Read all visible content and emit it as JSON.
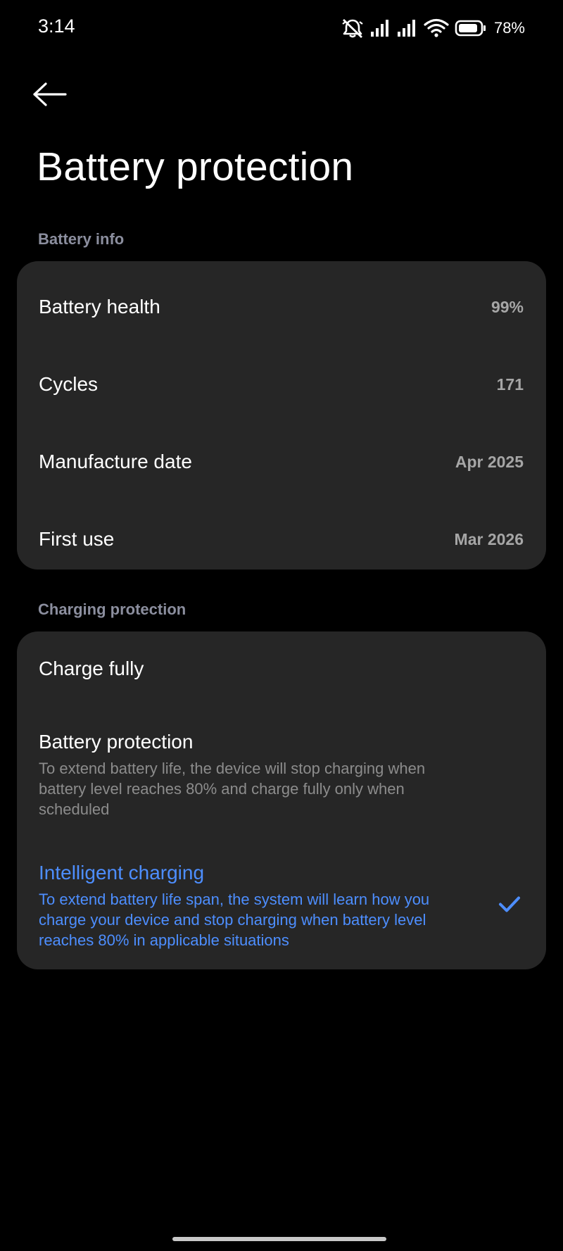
{
  "status_bar": {
    "time": "3:14",
    "battery_percent": "78%",
    "icons": [
      "mute-bell-icon",
      "signal-icon",
      "signal-icon",
      "wifi-icon",
      "battery-icon"
    ]
  },
  "header": {
    "back_icon": "arrow-left-icon",
    "title": "Battery protection"
  },
  "battery_info": {
    "header": "Battery info",
    "rows": [
      {
        "label": "Battery health",
        "value": "99%"
      },
      {
        "label": "Cycles",
        "value": "171"
      },
      {
        "label": "Manufacture date",
        "value": "Apr 2025"
      },
      {
        "label": "First use",
        "value": "Mar 2026"
      }
    ]
  },
  "charging_protection": {
    "header": "Charging protection",
    "options": [
      {
        "title": "Charge fully",
        "description": "",
        "selected": false
      },
      {
        "title": "Battery protection",
        "description": "To extend battery life, the device will stop charging when battery level reaches 80% and charge fully only when scheduled",
        "selected": false
      },
      {
        "title": "Intelligent charging",
        "description": "To extend battery life span, the system will learn how you charge your device and stop charging when battery level reaches 80% in applicable situations",
        "selected": true
      }
    ]
  },
  "colors": {
    "background": "#000000",
    "card": "#262626",
    "accent": "#4d8eff",
    "section_header": "#8b8e9e",
    "secondary_text": "#8c8c8c"
  }
}
